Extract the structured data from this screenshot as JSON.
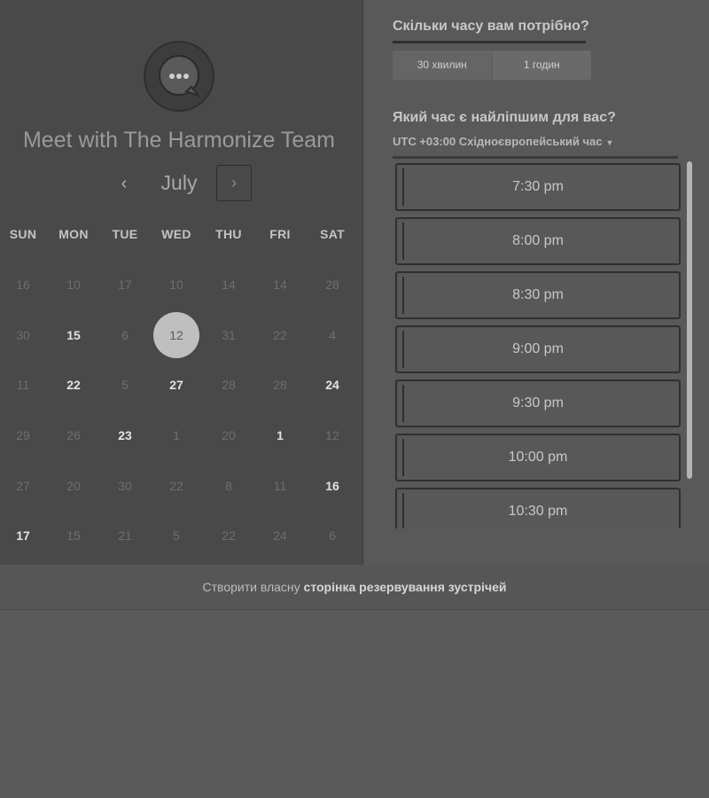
{
  "team": {
    "title": "Meet with The Harmonize Team",
    "avatar_icon": "chat-bubble-icon"
  },
  "calendar": {
    "prev_label": "‹",
    "month": "July",
    "next_label": "›",
    "weekdays": [
      "SUN",
      "MON",
      "TUE",
      "WED",
      "THU",
      "FRI",
      "SAT"
    ],
    "weeks": [
      [
        {
          "d": "16",
          "s": "u"
        },
        {
          "d": "10",
          "s": "u"
        },
        {
          "d": "17",
          "s": "u"
        },
        {
          "d": "10",
          "s": "u"
        },
        {
          "d": "14",
          "s": "u"
        },
        {
          "d": "14",
          "s": "u"
        },
        {
          "d": "28",
          "s": "u"
        }
      ],
      [
        {
          "d": "30",
          "s": "u"
        },
        {
          "d": "15",
          "s": "a"
        },
        {
          "d": "6",
          "s": "u"
        },
        {
          "d": "12",
          "s": "sel"
        },
        {
          "d": "31",
          "s": "u"
        },
        {
          "d": "22",
          "s": "u"
        },
        {
          "d": "4",
          "s": "u"
        }
      ],
      [
        {
          "d": "11",
          "s": "u"
        },
        {
          "d": "22",
          "s": "a"
        },
        {
          "d": "5",
          "s": "u"
        },
        {
          "d": "27",
          "s": "a"
        },
        {
          "d": "28",
          "s": "u"
        },
        {
          "d": "28",
          "s": "u"
        },
        {
          "d": "24",
          "s": "a"
        }
      ],
      [
        {
          "d": "29",
          "s": "u"
        },
        {
          "d": "26",
          "s": "u"
        },
        {
          "d": "23",
          "s": "a"
        },
        {
          "d": "1",
          "s": "u"
        },
        {
          "d": "20",
          "s": "u"
        },
        {
          "d": "1",
          "s": "a"
        },
        {
          "d": "12",
          "s": "u"
        }
      ],
      [
        {
          "d": "27",
          "s": "u"
        },
        {
          "d": "20",
          "s": "u"
        },
        {
          "d": "30",
          "s": "u"
        },
        {
          "d": "22",
          "s": "u"
        },
        {
          "d": "8",
          "s": "u"
        },
        {
          "d": "11",
          "s": "u"
        },
        {
          "d": "16",
          "s": "a"
        }
      ],
      [
        {
          "d": "17",
          "s": "a"
        },
        {
          "d": "15",
          "s": "u"
        },
        {
          "d": "21",
          "s": "u"
        },
        {
          "d": "5",
          "s": "u"
        },
        {
          "d": "22",
          "s": "u"
        },
        {
          "d": "24",
          "s": "u"
        },
        {
          "d": "6",
          "s": "u"
        }
      ]
    ]
  },
  "duration": {
    "heading": "Скільки часу вам потрібно?",
    "options": [
      "30 хвилин",
      "1 годин"
    ]
  },
  "times": {
    "heading": "Який час є найліпшим для вас?",
    "timezone": "UTC +03:00 Східноєвропейський час",
    "slots": [
      "7:30 pm",
      "8:00 pm",
      "8:30 pm",
      "9:00 pm",
      "9:30 pm",
      "10:00 pm",
      "10:30 pm"
    ]
  },
  "footer": {
    "link_prefix": "Створити власну",
    "link_bold": "сторінка резервування зустрічей"
  }
}
